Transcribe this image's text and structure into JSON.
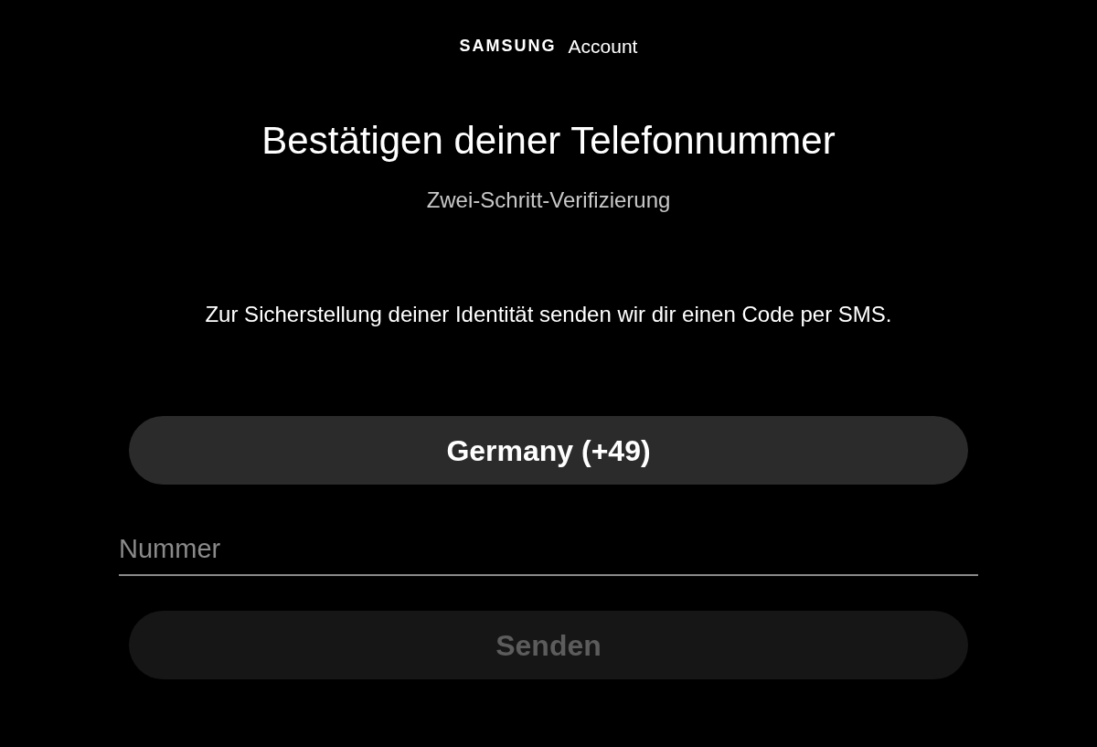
{
  "header": {
    "brand": "SAMSUNG",
    "product": "Account"
  },
  "title": "Bestätigen deiner Telefonnummer",
  "subtitle": "Zwei-Schritt-Verifizierung",
  "message": "Zur Sicherstellung deiner Identität senden wir dir einen Code per SMS.",
  "country_button": {
    "label": "Germany (+49)"
  },
  "number_field": {
    "placeholder": "Nummer"
  },
  "send_button": {
    "label": "Senden",
    "disabled": true
  }
}
